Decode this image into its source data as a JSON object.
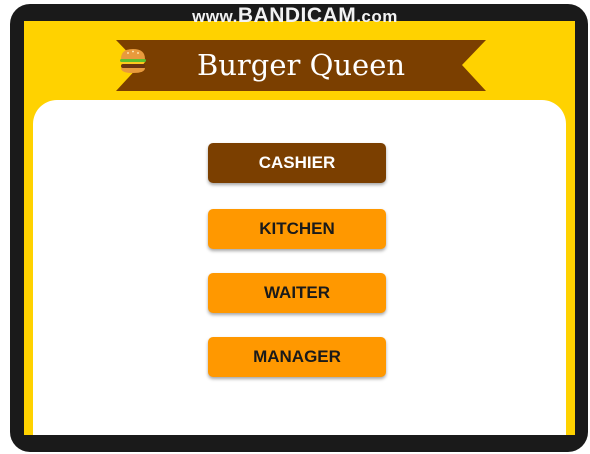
{
  "watermark": {
    "prefix": "www.",
    "brand": "BANDICAM",
    "suffix": ".com"
  },
  "header": {
    "title": "Burger Queen",
    "icon": "burger-icon"
  },
  "roles": [
    {
      "label": "CASHIER",
      "selected": true
    },
    {
      "label": "KITCHEN",
      "selected": false
    },
    {
      "label": "WAITER",
      "selected": false
    },
    {
      "label": "MANAGER",
      "selected": false
    }
  ],
  "colors": {
    "background": "#ffd200",
    "banner": "#7b3f00",
    "button": "#ff9800",
    "button_selected": "#7b3f00"
  }
}
